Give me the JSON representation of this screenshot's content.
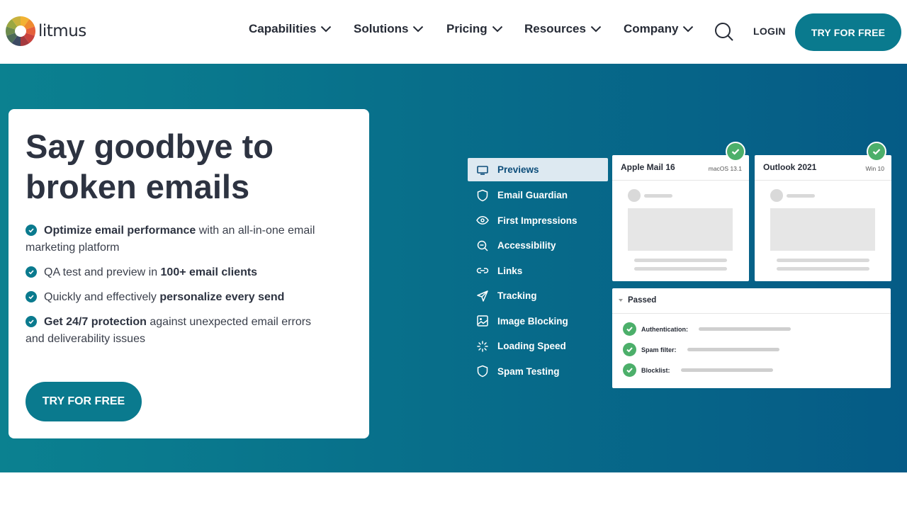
{
  "header": {
    "logo_text": "litmus",
    "nav": [
      {
        "label": "Capabilities"
      },
      {
        "label": "Solutions"
      },
      {
        "label": "Pricing"
      },
      {
        "label": "Resources"
      },
      {
        "label": "Company"
      }
    ],
    "login_label": "LOGIN",
    "cta_label": "TRY FOR FREE"
  },
  "hero": {
    "headline": "Say goodbye to broken emails",
    "bullets": [
      {
        "bold": "Optimize email performance",
        "rest": " with an all-in-one email marketing platform"
      },
      {
        "pre": "QA test and preview in ",
        "bold": "100+ email clients"
      },
      {
        "pre": "Quickly and effectively ",
        "bold": "personalize every send"
      },
      {
        "bold": "Get 24/7 protection",
        "rest": " against unexpected email errors and deliverability issues"
      }
    ],
    "cta_label": "TRY FOR FREE"
  },
  "illustration": {
    "menu": [
      {
        "label": "Previews",
        "icon": "monitor-icon",
        "active": true
      },
      {
        "label": "Email Guardian",
        "icon": "shield-icon"
      },
      {
        "label": "First Impressions",
        "icon": "eye-icon"
      },
      {
        "label": "Accessibility",
        "icon": "magnifier-icon"
      },
      {
        "label": "Links",
        "icon": "link-icon"
      },
      {
        "label": "Tracking",
        "icon": "send-icon"
      },
      {
        "label": "Image Blocking",
        "icon": "image-icon"
      },
      {
        "label": "Loading Speed",
        "icon": "spinner-icon"
      },
      {
        "label": "Spam Testing",
        "icon": "shield-icon"
      }
    ],
    "previews": [
      {
        "title": "Apple Mail 16",
        "os": "macOS 13.1"
      },
      {
        "title": "Outlook 2021",
        "os": "Win 10"
      }
    ],
    "passed": {
      "title": "Passed",
      "checks": [
        "Authentication:",
        "Spam filter:",
        "Blocklist:"
      ]
    }
  },
  "colors": {
    "brand_teal": "#0a7a8e",
    "hero_gradient_start": "#0b8190",
    "hero_gradient_end": "#055b86",
    "check_green": "#4caf6a"
  }
}
